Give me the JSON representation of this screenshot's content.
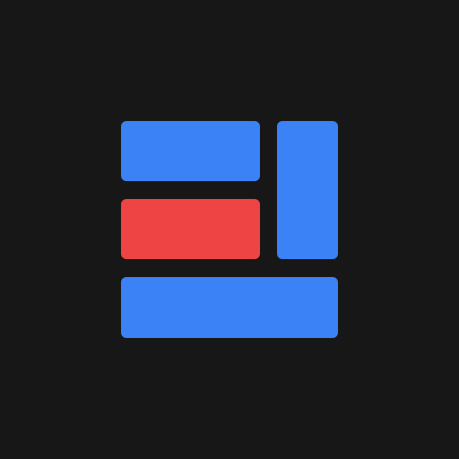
{
  "colors": {
    "background": "#171717",
    "blue": "#3b82f6",
    "red": "#ef4444"
  },
  "blocks": [
    {
      "id": "block-top-left",
      "color": "blue"
    },
    {
      "id": "block-middle-left",
      "color": "red"
    },
    {
      "id": "block-right-vertical",
      "color": "blue"
    },
    {
      "id": "block-bottom-wide",
      "color": "blue"
    }
  ]
}
